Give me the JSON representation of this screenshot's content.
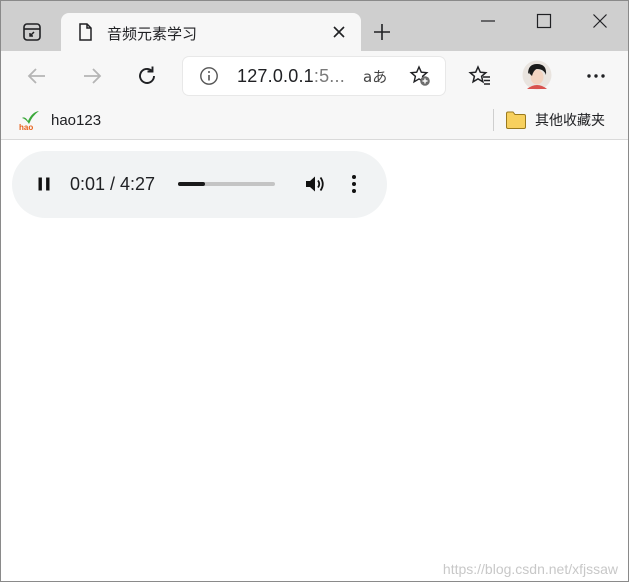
{
  "tab": {
    "title": "音频元素学习"
  },
  "toolbar": {
    "url_main": "127.0.0.1",
    "url_rest": ":5...",
    "read_aloud_glyph": "aあ"
  },
  "bookmarks": {
    "left_label": "hao123",
    "left_logo_text": "hao",
    "right_label": "其他收藏夹"
  },
  "audio": {
    "time": "0:01 / 4:27",
    "progress": 0.28
  },
  "watermark": "https://blog.csdn.net/xfjssaw",
  "colors": {
    "tabstrip": "#cfcfcf",
    "toolbar": "#f7f7f7",
    "player_bg": "#f1f3f4",
    "folder": "#f7d05e"
  },
  "icons": [
    "tab-actions-icon",
    "page-icon",
    "close-icon",
    "plus-icon",
    "minimize-icon",
    "maximize-icon",
    "window-close-icon",
    "back-arrow-icon",
    "forward-arrow-icon",
    "refresh-icon",
    "info-icon",
    "add-favorite-icon",
    "favorites-icon",
    "avatar",
    "more-icon",
    "folder-icon",
    "pause-icon",
    "volume-icon",
    "overflow-icon"
  ]
}
